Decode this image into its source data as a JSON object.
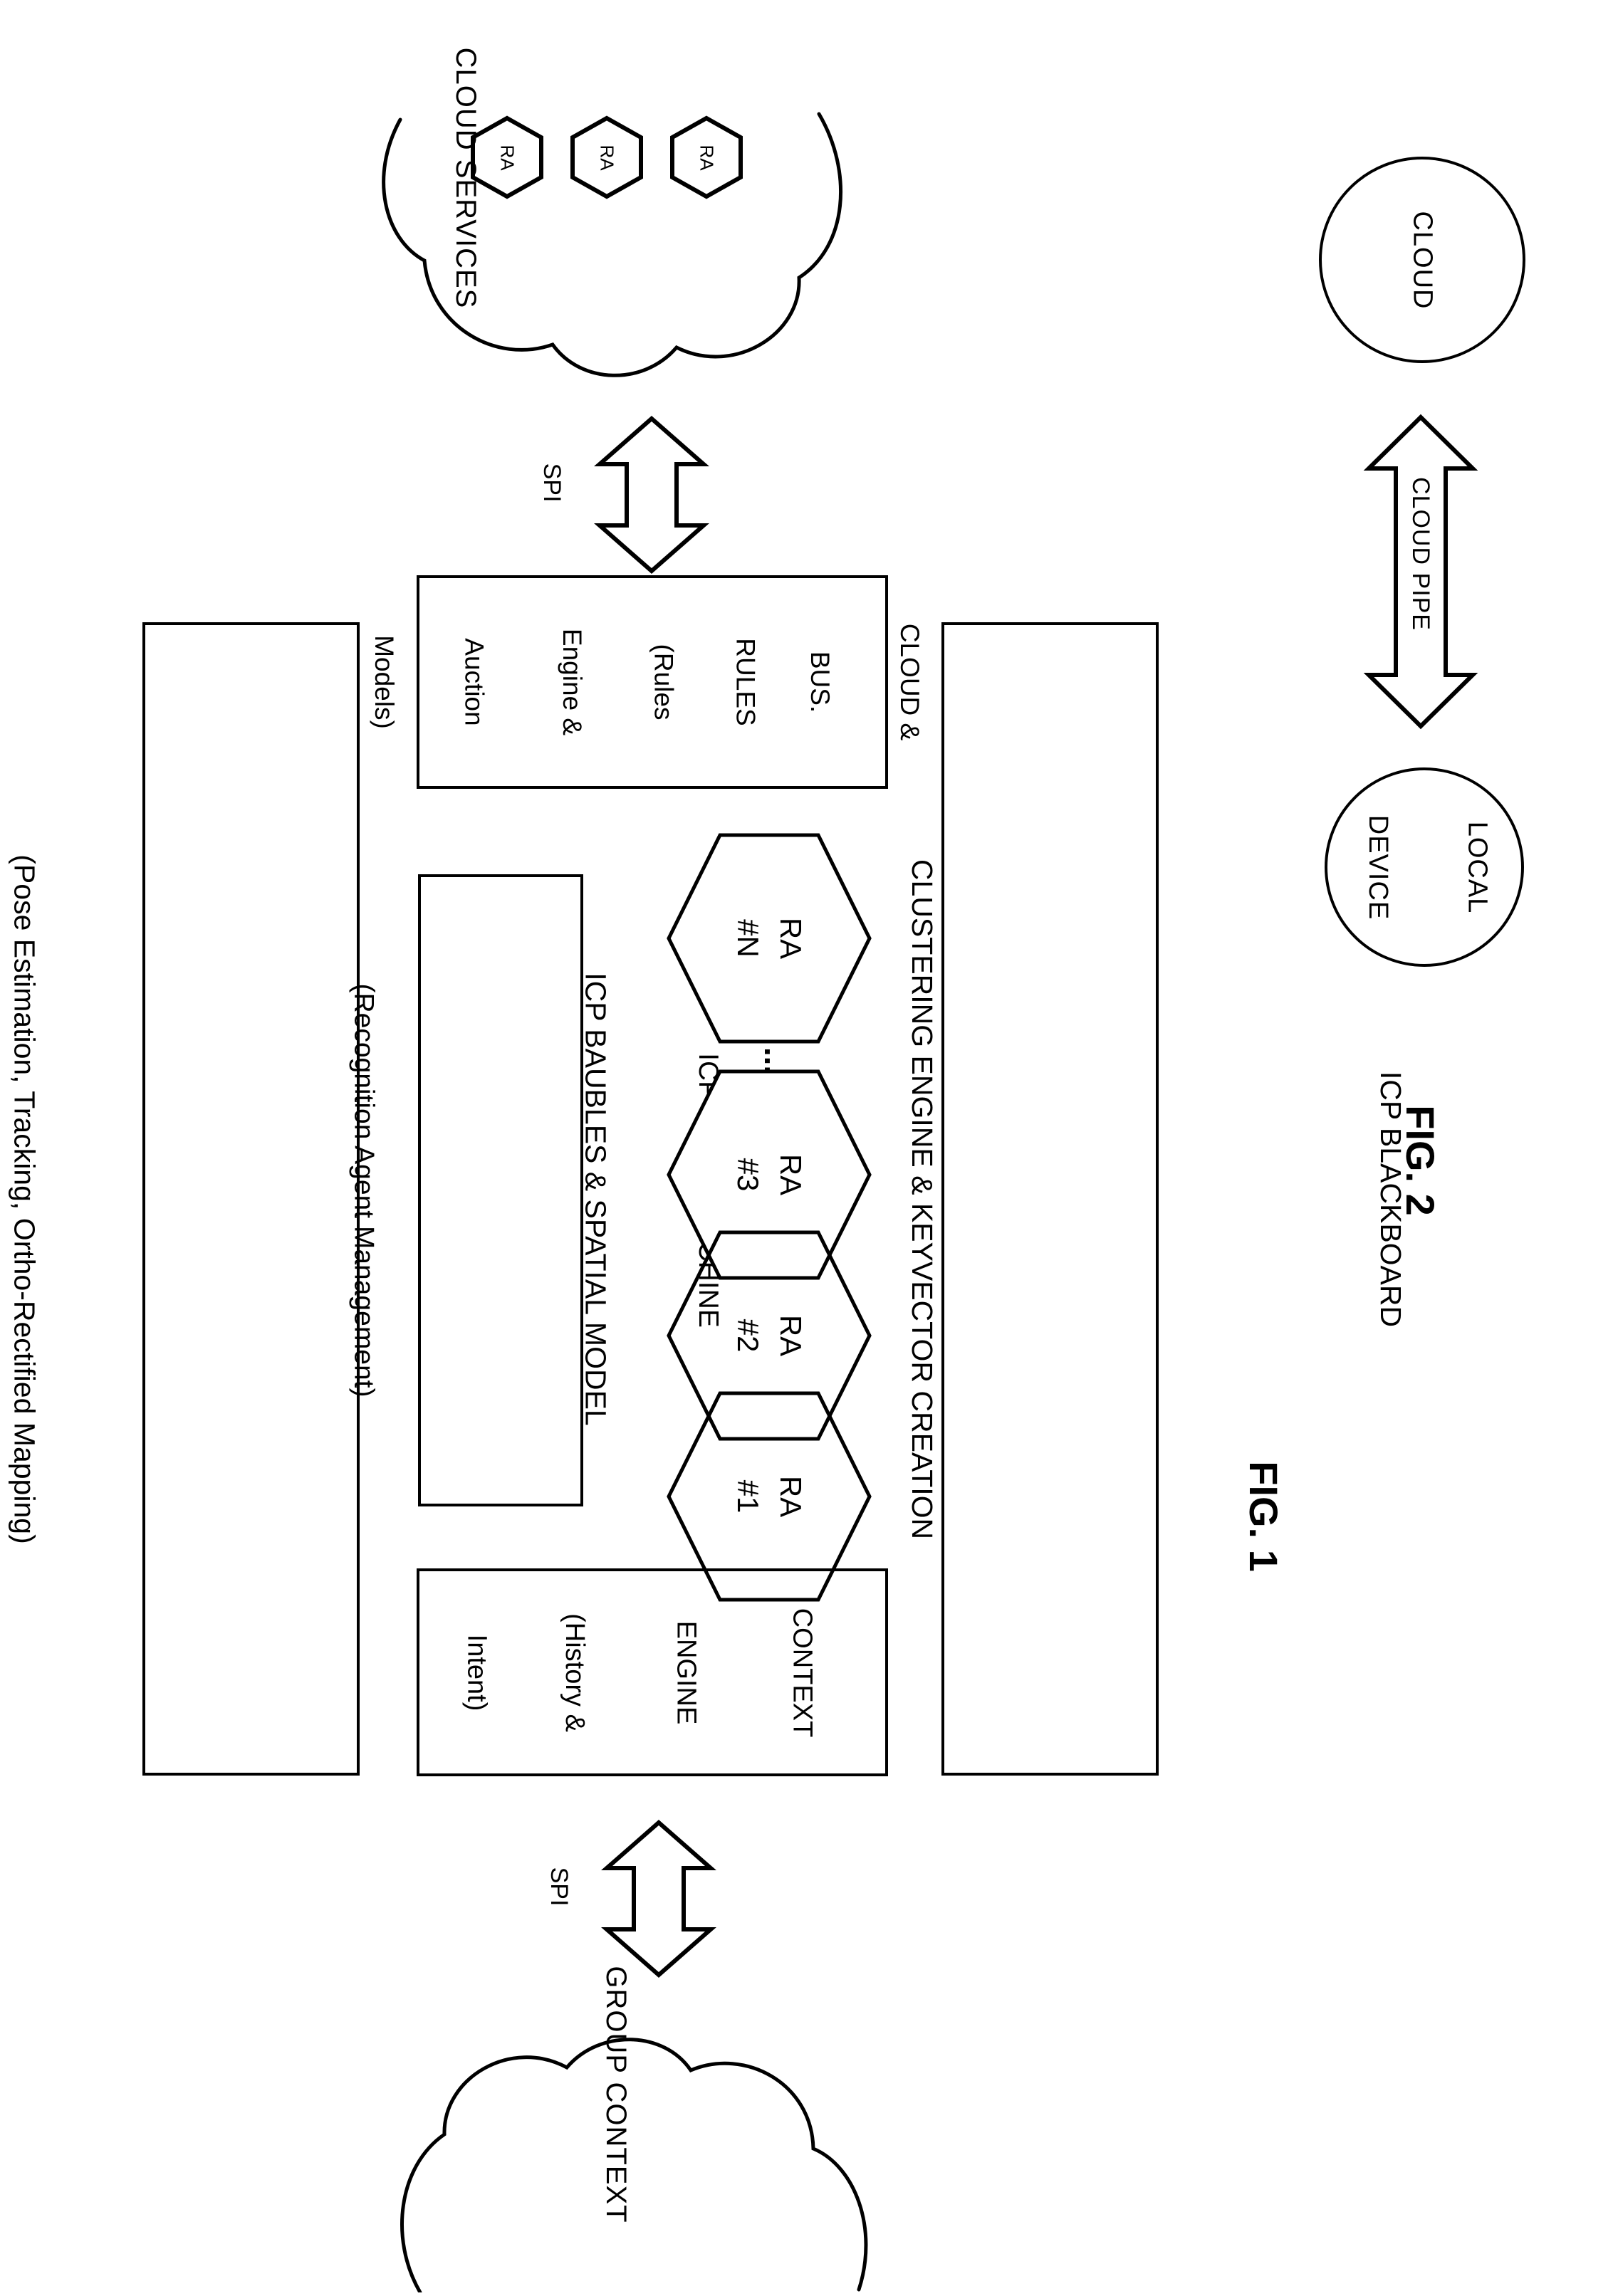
{
  "figure1": {
    "caption": "FIG. 1",
    "cloud_services": {
      "label": "CLOUD SERVICES",
      "agents": [
        {
          "label": "RA"
        },
        {
          "label": "RA"
        },
        {
          "label": "RA"
        }
      ]
    },
    "group_context": {
      "label": "GROUP CONTEXT"
    },
    "spi_top": "SPI",
    "spi_bottom": "SPI",
    "blocks": {
      "baubles": {
        "line1": "ICP BAUBLES & SPATIAL MODEL",
        "line2": "(Pose Estimation, Tracking, Ortho-Rectified Mapping)"
      },
      "cloud_bus_rules": {
        "line1": "CLOUD &",
        "line2": "BUS.",
        "line3": "RULES",
        "line4": "(Rules",
        "line5": "Engine &",
        "line6": "Auction",
        "line7": "Models)"
      },
      "state_machine": {
        "line1": "ICP STATE MACHINE",
        "line2": "(Recognition Agent Management)"
      },
      "context_engine": {
        "line1": "CONTEXT",
        "line2": "ENGINE",
        "line3": "(History &",
        "line4": "Intent)"
      },
      "blackboard": {
        "line1": "ICP BLACKBOARD",
        "line2": "CLUSTERING ENGINE & KEYVECTOR CREATION"
      }
    },
    "recognition_agents": [
      {
        "name": "RA",
        "number": "#1"
      },
      {
        "name": "RA",
        "number": "#2"
      },
      {
        "name": "RA",
        "number": "#3"
      },
      {
        "name": "RA",
        "number": "#N"
      }
    ],
    "ellipsis": "..."
  },
  "figure2": {
    "caption": "FIG. 2",
    "cloud_node": "CLOUD",
    "local_device": {
      "line1": "LOCAL",
      "line2": "DEVICE"
    },
    "pipe_label": "CLOUD PIPE"
  },
  "colors": {
    "stroke": "#000000",
    "background": "#ffffff"
  }
}
